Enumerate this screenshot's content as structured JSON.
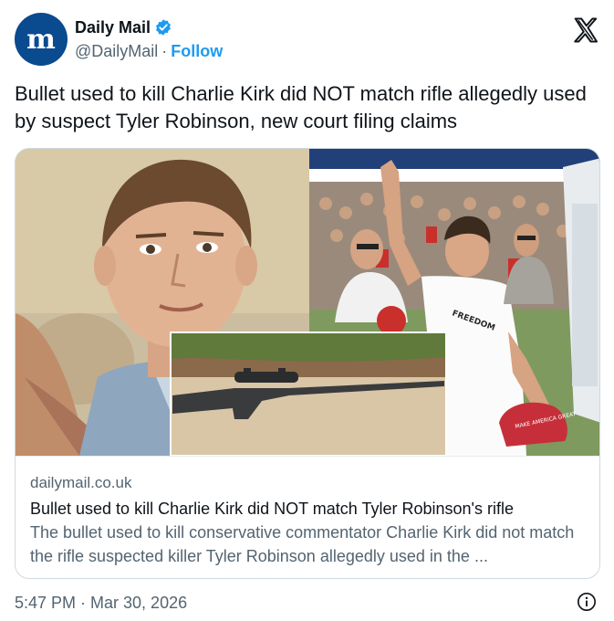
{
  "account": {
    "name": "Daily Mail",
    "handle": "@DailyMail",
    "separator": "·",
    "follow_label": "Follow",
    "avatar_icon": "daily-mail-logo",
    "verified_icon": "verified-badge-icon",
    "brand_color": "#0a4a8f",
    "verified_color": "#1d9bf0"
  },
  "platform_icon": "x-logo-icon",
  "tweet": {
    "text": "Bullet used to kill Charlie Kirk did NOT match rifle allegedly used by suspect Tyler Robinson, new court filing claims"
  },
  "card": {
    "domain": "dailymail.co.uk",
    "title": "Bullet used to kill Charlie Kirk did NOT match Tyler Robinson's rifle",
    "description": "The bullet used to kill conservative commentator Charlie Kirk did not match the rifle suspected killer Tyler Robinson allegedly used in the ...",
    "image_panels": [
      "portrait-photo",
      "crowd-rally-photo",
      "rifle-photo"
    ],
    "shirt_text": "FREEDOM",
    "hat_text": "MAKE AMERICA GREAT"
  },
  "footer": {
    "timestamp": "5:47 PM · Mar 30, 2026",
    "info_icon": "info-icon"
  }
}
